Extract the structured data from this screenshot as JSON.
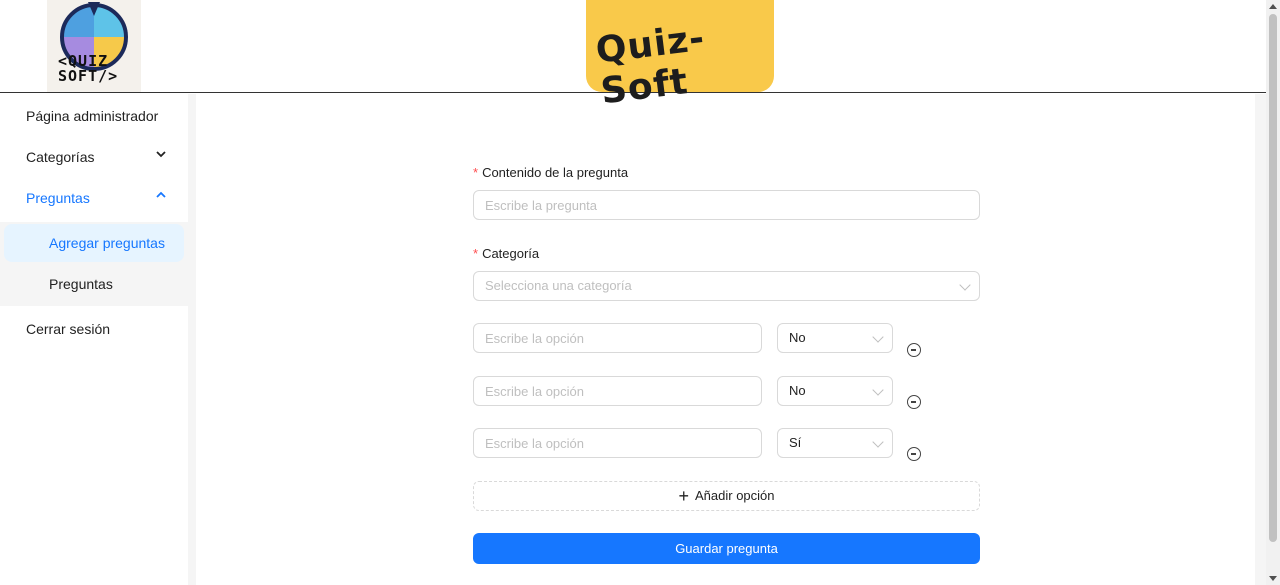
{
  "header": {
    "logo_text_line1": "<QUIZ",
    "logo_text_line2": "SOFT/>",
    "brand_title": "Quiz-Soft"
  },
  "sidebar": {
    "items": [
      {
        "label": "Página administrador"
      },
      {
        "label": "Categorías"
      },
      {
        "label": "Preguntas"
      },
      {
        "label": "Cerrar sesión"
      }
    ],
    "submenu": [
      {
        "label": "Agregar preguntas",
        "selected": true
      },
      {
        "label": "Preguntas",
        "selected": false
      }
    ]
  },
  "form": {
    "question_label": "Contenido de la pregunta",
    "question_placeholder": "Escribe la pregunta",
    "category_label": "Categoría",
    "category_placeholder": "Selecciona una categoría",
    "required_mark": "*",
    "options": [
      {
        "placeholder": "Escribe la opción",
        "correct": "No"
      },
      {
        "placeholder": "Escribe la opción",
        "correct": "No"
      },
      {
        "placeholder": "Escribe la opción",
        "correct": "Sí"
      }
    ],
    "add_option_label": "Añadir opción",
    "save_label": "Guardar pregunta"
  },
  "colors": {
    "primary": "#1677ff",
    "brand_yellow": "#f9c94a",
    "required": "#ff4d4f"
  }
}
